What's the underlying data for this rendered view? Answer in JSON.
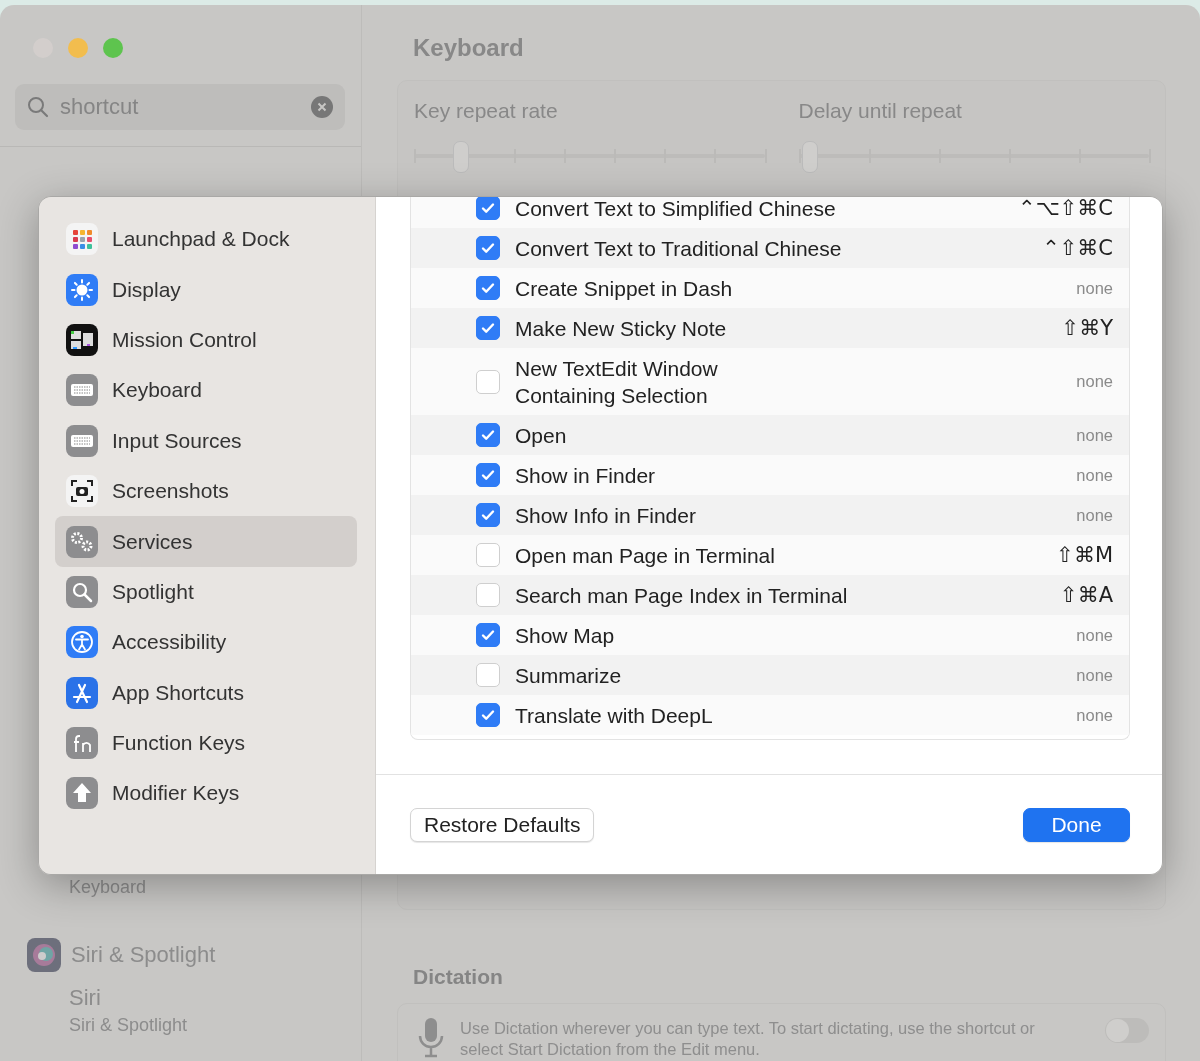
{
  "window": {
    "title": "Keyboard",
    "search": {
      "value": "shortcut"
    }
  },
  "search_results": [
    {
      "title": "Keyboard",
      "kind": "subtitle"
    },
    {
      "title": "Siri & Spotlight",
      "kind": "category"
    },
    {
      "title": "Siri",
      "kind": "item"
    },
    {
      "title": "Siri & Spotlight",
      "kind": "subtitle"
    }
  ],
  "sliders": [
    {
      "label": "Key repeat rate",
      "level": 0.13
    },
    {
      "label": "Delay until repeat",
      "level": 0.01
    }
  ],
  "dictation": {
    "title": "Dictation",
    "text": "Use Dictation wherever you can type text. To start dictating, use the shortcut or select Start Dictation from the Edit menu.",
    "on": false
  },
  "sheet": {
    "sidebar": [
      {
        "label": "Launchpad & Dock",
        "selected": false
      },
      {
        "label": "Display",
        "selected": false
      },
      {
        "label": "Mission Control",
        "selected": false
      },
      {
        "label": "Keyboard",
        "selected": false
      },
      {
        "label": "Input Sources",
        "selected": false
      },
      {
        "label": "Screenshots",
        "selected": false
      },
      {
        "label": "Services",
        "selected": true
      },
      {
        "label": "Spotlight",
        "selected": false
      },
      {
        "label": "Accessibility",
        "selected": false
      },
      {
        "label": "App Shortcuts",
        "selected": false
      },
      {
        "label": "Function Keys",
        "selected": false
      },
      {
        "label": "Modifier Keys",
        "selected": false
      }
    ],
    "services": [
      {
        "name": "Convert Text to Simplified Chinese",
        "checked": true,
        "shortcut": "⌃⌥⇧⌘C"
      },
      {
        "name": "Convert Text to Traditional Chinese",
        "checked": true,
        "shortcut": "⌃⇧⌘C"
      },
      {
        "name": "Create Snippet in Dash",
        "checked": true,
        "shortcut": "none"
      },
      {
        "name": "Make New Sticky Note",
        "checked": true,
        "shortcut": "⇧⌘Y"
      },
      {
        "name": "New TextEdit Window\nContaining Selection",
        "checked": false,
        "shortcut": "none"
      },
      {
        "name": "Open",
        "checked": true,
        "shortcut": "none"
      },
      {
        "name": "Show in Finder",
        "checked": true,
        "shortcut": "none"
      },
      {
        "name": "Show Info in Finder",
        "checked": true,
        "shortcut": "none"
      },
      {
        "name": "Open man Page in Terminal",
        "checked": false,
        "shortcut": "⇧⌘M"
      },
      {
        "name": "Search man Page Index in Terminal",
        "checked": false,
        "shortcut": "⇧⌘A"
      },
      {
        "name": "Show Map",
        "checked": true,
        "shortcut": "none"
      },
      {
        "name": "Summarize",
        "checked": false,
        "shortcut": "none"
      },
      {
        "name": "Translate with DeepL",
        "checked": true,
        "shortcut": "none"
      }
    ],
    "buttons": [
      {
        "label": "Restore Defaults",
        "kind": "secondary"
      },
      {
        "label": "Done",
        "kind": "primary"
      }
    ]
  }
}
